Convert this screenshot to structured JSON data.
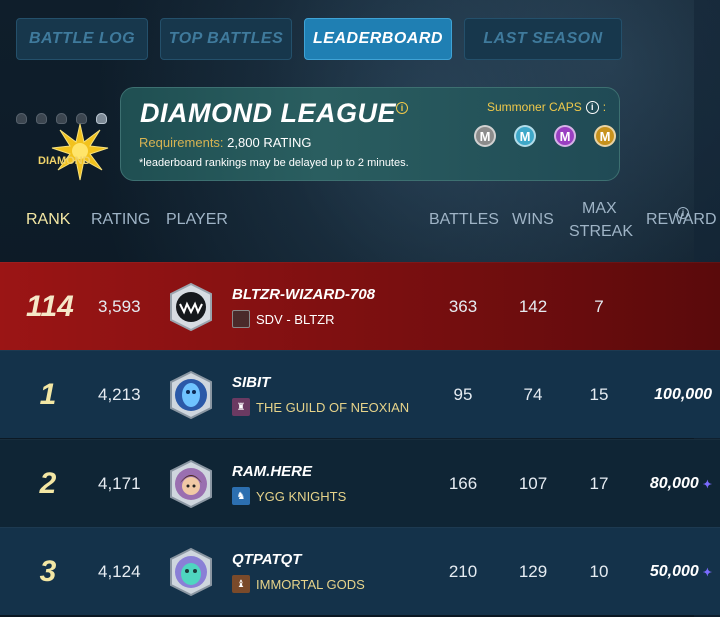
{
  "tabs": [
    {
      "label": "BATTLE LOG",
      "active": false
    },
    {
      "label": "TOP BATTLES",
      "active": false
    },
    {
      "label": "LEADERBOARD",
      "active": true
    },
    {
      "label": "LAST SEASON",
      "active": false
    }
  ],
  "league": {
    "badge_label": "DIAMOND",
    "title": "DIAMOND LEAGUE",
    "requirements_label": "Requirements:",
    "requirements_value": "2,800 RATING",
    "delay_note": "*leaderboard rankings may be delayed up to 2 minutes.",
    "caps_label": "Summoner CAPS",
    "caps_suffix": ":",
    "caps": [
      {
        "letter": "M",
        "color": "#8c8c8c"
      },
      {
        "letter": "M",
        "color": "#3fa8c9"
      },
      {
        "letter": "M",
        "color": "#9a3fc2"
      },
      {
        "letter": "M",
        "color": "#c7921d"
      }
    ]
  },
  "columns": {
    "rank": "RANK",
    "rating": "RATING",
    "player": "PLAYER",
    "battles": "BATTLES",
    "wins": "WINS",
    "max_streak_1": "MAX",
    "max_streak_2": "STREAK",
    "reward": "REWARD"
  },
  "rows": [
    {
      "rank": "114",
      "rating": "3,593",
      "player": "BLTZR-WIZARD-708",
      "guild": "SDV - BLTZR",
      "battles": "363",
      "wins": "142",
      "streak": "7",
      "reward": "",
      "avatar": "monster-avatar",
      "current_user": true
    },
    {
      "rank": "1",
      "rating": "4,213",
      "player": "SIBIT",
      "guild": "THE GUILD OF NEOXIAN",
      "battles": "95",
      "wins": "74",
      "streak": "15",
      "reward": "100,000",
      "avatar": "ghost-avatar"
    },
    {
      "rank": "2",
      "rating": "4,171",
      "player": "RAM.HERE",
      "guild": "YGG KNIGHTS",
      "battles": "166",
      "wins": "107",
      "streak": "17",
      "reward": "80,000",
      "avatar": "girl-avatar"
    },
    {
      "rank": "3",
      "rating": "4,124",
      "player": "QTPATQT",
      "guild": "IMMORTAL GODS",
      "battles": "210",
      "wins": "129",
      "streak": "10",
      "reward": "50,000",
      "avatar": "creature-avatar"
    }
  ],
  "reward_currency_icon": "dec-icon"
}
